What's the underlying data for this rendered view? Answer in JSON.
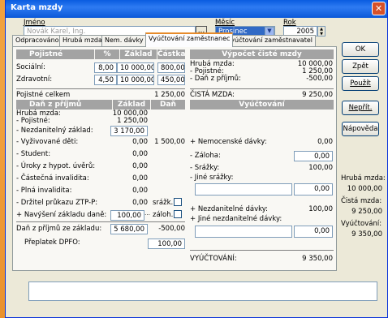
{
  "window": {
    "title": "Karta mzdy",
    "close": "✕"
  },
  "top": {
    "jmeno_label": "Jméno",
    "jmeno_value": "Novák Karel, Ing.",
    "ellipsis": "…",
    "mesic_label": "Měsíc",
    "mesic_value": "Prosinec",
    "rok_label": "Rok",
    "rok_value": "2005"
  },
  "tabs": [
    "Odpracováno",
    "Hrubá mzda",
    "Nem. dávky",
    "Vyúčtování zaměstnanec",
    "Vyúčtování zaměstnavatel"
  ],
  "buttons": {
    "ok": "OK",
    "zpet": "Zpět",
    "pouzit": "Použít",
    "neprit": "Nepřít.",
    "napoveda": "Nápověda"
  },
  "poj": {
    "h1": "Pojistné",
    "h2": "%",
    "h3": "Základ",
    "h4": "Částka",
    "rows": [
      {
        "label": "Sociální:",
        "pct": "8,00",
        "zaklad": "10 000,00",
        "castka": "800,00"
      },
      {
        "label": "Zdravotní:",
        "pct": "4,50",
        "zaklad": "10 000,00",
        "castka": "450,00"
      }
    ],
    "celkem_label": "Pojistné celkem",
    "celkem_value": "1 250,00"
  },
  "dan": {
    "h1": "Daň z příjmů",
    "h2": "Základ",
    "h3": "Daň",
    "hruba_label": "Hrubá mzda:",
    "hruba_value": "10 000,00",
    "pojistne_label": "- Pojistné:",
    "pojistne_value": "1 250,00",
    "nezdan_label": "- Nezdanitelný základ:",
    "nezdan_value": "3 170,00",
    "deti_label": "- Vyživované děti:",
    "deti_value": "0,00",
    "deti_dan": "1 500,00",
    "student_label": "- Student:",
    "student_value": "0,00",
    "uroky_label": "- Úroky z hypot. úvěrů:",
    "uroky_value": "0,00",
    "castinv_label": "- Částečná invalidita:",
    "castinv_value": "0,00",
    "plnainv_label": "- Plná invalidita:",
    "plnainv_value": "0,00",
    "ztp_label": "- Držitel průkazu ZTP-P:",
    "ztp_value": "0,00",
    "srazk_label": "srážk.",
    "navys_label": "+ Navýšení základu daně:",
    "navys_value": "100,00",
    "zaloh_label": "záloh.",
    "zaklad_label": "Daň z příjmů ze základu:",
    "zaklad_value": "5 680,00",
    "zaklad_dan": "-500,00",
    "preplatek_label": "Přeplatek DPFO:",
    "preplatek_value": "100,00"
  },
  "vypocet": {
    "header": "Výpočet čisté mzdy",
    "hruba_label": "Hrubá mzda:",
    "hruba_value": "10 000,00",
    "pojistne_label": "- Pojistné:",
    "pojistne_value": "1 250,00",
    "dan_label": "- Daň z příjmů:",
    "dan_value": "-500,00",
    "cista_label": "ČISTÁ MZDA:",
    "cista_value": "9 250,00"
  },
  "vyuct": {
    "header": "Vyúčtování",
    "nemoc_label": "+ Nemocenské dávky:",
    "nemoc_value": "0,00",
    "zaloha_label": "- Záloha:",
    "zaloha_value": "0,00",
    "srazky_label": "- Srážky:",
    "srazky_value": "100,00",
    "jine_label": "- Jiné srážky:",
    "jine_value": "0,00",
    "nezdandav_label": "+ Nezdanitelné dávky:",
    "nezdandav_value": "100,00",
    "jinenezdan_label": "+ Jiné nezdanitelné dávky:",
    "jinenezdan_value": "0,00",
    "total_label": "VYÚČTOVÁNÍ:",
    "total_value": "9 350,00"
  },
  "summary": {
    "hruba_label": "Hrubá mzda:",
    "hruba_value": "10 000,00",
    "cista_label": "Čistá mzda:",
    "cista_value": "9 250,00",
    "vyuct_label": "Vyúčtování:",
    "vyuct_value": "9 350,00"
  }
}
